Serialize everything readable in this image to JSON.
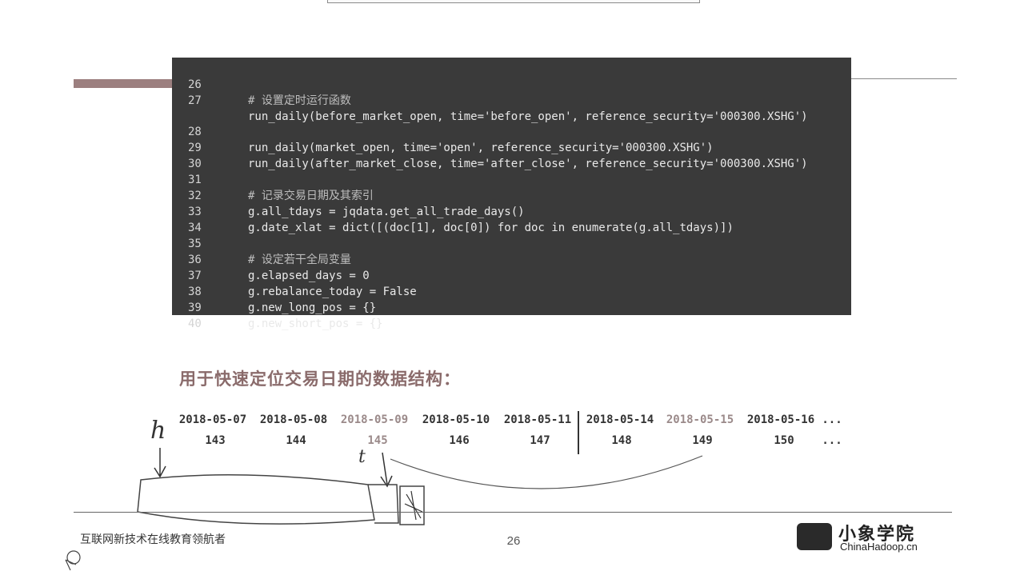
{
  "code": {
    "lines": [
      {
        "num": "26",
        "text": "# 设置定时运行函数",
        "comment": true
      },
      {
        "num": "27",
        "text": "run_daily(before_market_open, time='before_open', reference_security='000300.XSHG')"
      },
      {
        "num": "28",
        "text": "run_daily(market_open, time='open', reference_security='000300.XSHG')"
      },
      {
        "num": "29",
        "text": "run_daily(after_market_close, time='after_close', reference_security='000300.XSHG')"
      },
      {
        "num": "30",
        "text": ""
      },
      {
        "num": "31",
        "text": "# 记录交易日期及其索引",
        "comment": true
      },
      {
        "num": "32",
        "text": "g.all_tdays = jqdata.get_all_trade_days()"
      },
      {
        "num": "33",
        "text": "g.date_xlat = dict([(doc[1], doc[0]) for doc in enumerate(g.all_tdays)])"
      },
      {
        "num": "34",
        "text": ""
      },
      {
        "num": "35",
        "text": "# 设定若干全局变量",
        "comment": true
      },
      {
        "num": "36",
        "text": "g.elapsed_days = 0"
      },
      {
        "num": "37",
        "text": "g.rebalance_today = False"
      },
      {
        "num": "38",
        "text": "g.new_long_pos = {}"
      },
      {
        "num": "39",
        "text": "g.new_short_pos = {}"
      },
      {
        "num": "40",
        "text": ""
      }
    ]
  },
  "subtitle": "用于快速定位交易日期的数据结构：",
  "dates": [
    "2018-05-07",
    "2018-05-08",
    "2018-05-09",
    "2018-05-10",
    "2018-05-11",
    "2018-05-14",
    "2018-05-15",
    "2018-05-16",
    "..."
  ],
  "indices": [
    "143",
    "144",
    "145",
    "146",
    "147",
    "148",
    "149",
    "150",
    "..."
  ],
  "annotations": {
    "h_label": "h",
    "t_label": "t"
  },
  "footer": {
    "text": "互联网新技术在线教育领航者",
    "page_number": "26"
  },
  "logo": {
    "title": "小象学院",
    "subtitle": "ChinaHadoop.cn"
  }
}
